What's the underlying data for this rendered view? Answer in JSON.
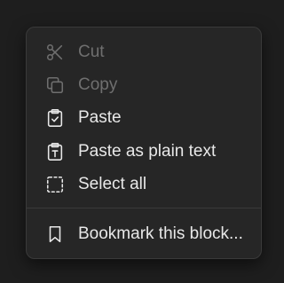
{
  "colors": {
    "background": "#1e1e1e",
    "menu_background": "#262626",
    "menu_border": "#3a3a3a",
    "text": "#e8e8e8",
    "text_disabled": "#6f6f6f"
  },
  "menu": {
    "items": [
      {
        "label": "Cut",
        "icon": "scissors-icon",
        "enabled": false
      },
      {
        "label": "Copy",
        "icon": "copy-icon",
        "enabled": false
      },
      {
        "label": "Paste",
        "icon": "clipboard-check-icon",
        "enabled": true
      },
      {
        "label": "Paste as plain text",
        "icon": "clipboard-text-icon",
        "enabled": true
      },
      {
        "label": "Select all",
        "icon": "select-all-icon",
        "enabled": true
      }
    ],
    "bookmark": {
      "label": "Bookmark this block...",
      "icon": "bookmark-icon",
      "enabled": true
    }
  }
}
